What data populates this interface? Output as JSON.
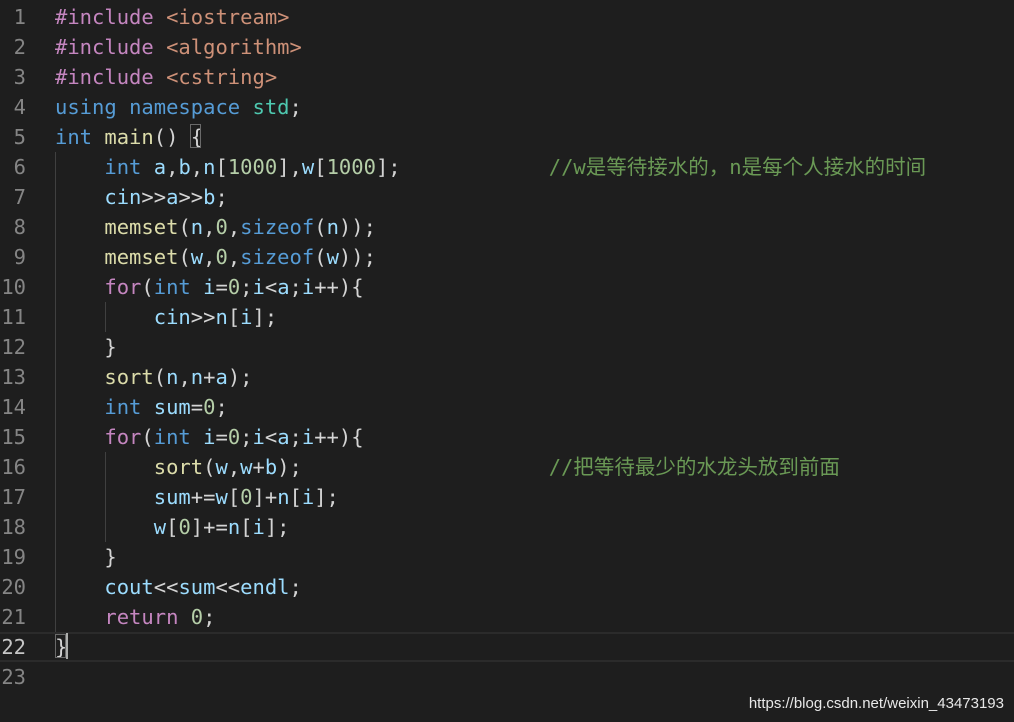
{
  "editor": {
    "lines": [
      [
        [
          "t-pre",
          "#include "
        ],
        [
          "t-str",
          "<iostream>"
        ]
      ],
      [
        [
          "t-pre",
          "#include "
        ],
        [
          "t-str",
          "<algorithm>"
        ]
      ],
      [
        [
          "t-pre",
          "#include "
        ],
        [
          "t-str",
          "<cstring>"
        ]
      ],
      [
        [
          "t-kw",
          "using "
        ],
        [
          "t-kw",
          "namespace "
        ],
        [
          "t-typ",
          "std"
        ],
        [
          "t-txt",
          ";"
        ]
      ],
      [
        [
          "t-kw",
          "int "
        ],
        [
          "t-fn",
          "main"
        ],
        [
          "t-txt",
          "() {"
        ]
      ],
      [
        [
          "t-txt",
          "    "
        ],
        [
          "t-kw",
          "int "
        ],
        [
          "t-var",
          "a"
        ],
        [
          "t-txt",
          ","
        ],
        [
          "t-var",
          "b"
        ],
        [
          "t-txt",
          ","
        ],
        [
          "t-var",
          "n"
        ],
        [
          "t-txt",
          "["
        ],
        [
          "t-num",
          "1000"
        ],
        [
          "t-txt",
          "],"
        ],
        [
          "t-var",
          "w"
        ],
        [
          "t-txt",
          "["
        ],
        [
          "t-num",
          "1000"
        ],
        [
          "t-txt",
          "];            "
        ],
        [
          "t-cmt",
          "//w是等待接水的，n是每个人接水的时间"
        ]
      ],
      [
        [
          "t-txt",
          "    "
        ],
        [
          "t-var",
          "cin"
        ],
        [
          "t-txt",
          ">>"
        ],
        [
          "t-var",
          "a"
        ],
        [
          "t-txt",
          ">>"
        ],
        [
          "t-var",
          "b"
        ],
        [
          "t-txt",
          ";"
        ]
      ],
      [
        [
          "t-txt",
          "    "
        ],
        [
          "t-fn",
          "memset"
        ],
        [
          "t-txt",
          "("
        ],
        [
          "t-var",
          "n"
        ],
        [
          "t-txt",
          ","
        ],
        [
          "t-num",
          "0"
        ],
        [
          "t-txt",
          ","
        ],
        [
          "t-kw",
          "sizeof"
        ],
        [
          "t-txt",
          "("
        ],
        [
          "t-var",
          "n"
        ],
        [
          "t-txt",
          "));"
        ]
      ],
      [
        [
          "t-txt",
          "    "
        ],
        [
          "t-fn",
          "memset"
        ],
        [
          "t-txt",
          "("
        ],
        [
          "t-var",
          "w"
        ],
        [
          "t-txt",
          ","
        ],
        [
          "t-num",
          "0"
        ],
        [
          "t-txt",
          ","
        ],
        [
          "t-kw",
          "sizeof"
        ],
        [
          "t-txt",
          "("
        ],
        [
          "t-var",
          "w"
        ],
        [
          "t-txt",
          "));"
        ]
      ],
      [
        [
          "t-txt",
          "    "
        ],
        [
          "t-ctl",
          "for"
        ],
        [
          "t-txt",
          "("
        ],
        [
          "t-kw",
          "int "
        ],
        [
          "t-var",
          "i"
        ],
        [
          "t-txt",
          "="
        ],
        [
          "t-num",
          "0"
        ],
        [
          "t-txt",
          ";"
        ],
        [
          "t-var",
          "i"
        ],
        [
          "t-txt",
          "<"
        ],
        [
          "t-var",
          "a"
        ],
        [
          "t-txt",
          ";"
        ],
        [
          "t-var",
          "i"
        ],
        [
          "t-txt",
          "++){"
        ]
      ],
      [
        [
          "t-txt",
          "        "
        ],
        [
          "t-var",
          "cin"
        ],
        [
          "t-txt",
          ">>"
        ],
        [
          "t-var",
          "n"
        ],
        [
          "t-txt",
          "["
        ],
        [
          "t-var",
          "i"
        ],
        [
          "t-txt",
          "];"
        ]
      ],
      [
        [
          "t-txt",
          "    }"
        ]
      ],
      [
        [
          "t-txt",
          "    "
        ],
        [
          "t-fn",
          "sort"
        ],
        [
          "t-txt",
          "("
        ],
        [
          "t-var",
          "n"
        ],
        [
          "t-txt",
          ","
        ],
        [
          "t-var",
          "n"
        ],
        [
          "t-txt",
          "+"
        ],
        [
          "t-var",
          "a"
        ],
        [
          "t-txt",
          ");"
        ]
      ],
      [
        [
          "t-txt",
          "    "
        ],
        [
          "t-kw",
          "int "
        ],
        [
          "t-var",
          "sum"
        ],
        [
          "t-txt",
          "="
        ],
        [
          "t-num",
          "0"
        ],
        [
          "t-txt",
          ";"
        ]
      ],
      [
        [
          "t-txt",
          "    "
        ],
        [
          "t-ctl",
          "for"
        ],
        [
          "t-txt",
          "("
        ],
        [
          "t-kw",
          "int "
        ],
        [
          "t-var",
          "i"
        ],
        [
          "t-txt",
          "="
        ],
        [
          "t-num",
          "0"
        ],
        [
          "t-txt",
          ";"
        ],
        [
          "t-var",
          "i"
        ],
        [
          "t-txt",
          "<"
        ],
        [
          "t-var",
          "a"
        ],
        [
          "t-txt",
          ";"
        ],
        [
          "t-var",
          "i"
        ],
        [
          "t-txt",
          "++){"
        ]
      ],
      [
        [
          "t-txt",
          "        "
        ],
        [
          "t-fn",
          "sort"
        ],
        [
          "t-txt",
          "("
        ],
        [
          "t-var",
          "w"
        ],
        [
          "t-txt",
          ","
        ],
        [
          "t-var",
          "w"
        ],
        [
          "t-txt",
          "+"
        ],
        [
          "t-var",
          "b"
        ],
        [
          "t-txt",
          ");                    "
        ],
        [
          "t-cmt",
          "//把等待最少的水龙头放到前面"
        ]
      ],
      [
        [
          "t-txt",
          "        "
        ],
        [
          "t-var",
          "sum"
        ],
        [
          "t-txt",
          "+="
        ],
        [
          "t-var",
          "w"
        ],
        [
          "t-txt",
          "["
        ],
        [
          "t-num",
          "0"
        ],
        [
          "t-txt",
          "]+"
        ],
        [
          "t-var",
          "n"
        ],
        [
          "t-txt",
          "["
        ],
        [
          "t-var",
          "i"
        ],
        [
          "t-txt",
          "];"
        ]
      ],
      [
        [
          "t-txt",
          "        "
        ],
        [
          "t-var",
          "w"
        ],
        [
          "t-txt",
          "["
        ],
        [
          "t-num",
          "0"
        ],
        [
          "t-txt",
          "]+="
        ],
        [
          "t-var",
          "n"
        ],
        [
          "t-txt",
          "["
        ],
        [
          "t-var",
          "i"
        ],
        [
          "t-txt",
          "];"
        ]
      ],
      [
        [
          "t-txt",
          "    }"
        ]
      ],
      [
        [
          "t-txt",
          "    "
        ],
        [
          "t-var",
          "cout"
        ],
        [
          "t-txt",
          "<<"
        ],
        [
          "t-var",
          "sum"
        ],
        [
          "t-txt",
          "<<"
        ],
        [
          "t-var",
          "endl"
        ],
        [
          "t-txt",
          ";"
        ]
      ],
      [
        [
          "t-txt",
          "    "
        ],
        [
          "t-ctl",
          "return "
        ],
        [
          "t-num",
          "0"
        ],
        [
          "t-txt",
          ";"
        ]
      ],
      [
        [
          "t-txt",
          "}"
        ]
      ],
      []
    ],
    "line_numbers": [
      "1",
      "2",
      "3",
      "4",
      "5",
      "6",
      "7",
      "8",
      "9",
      "10",
      "11",
      "12",
      "13",
      "14",
      "15",
      "16",
      "17",
      "18",
      "19",
      "20",
      "21",
      "22",
      "23"
    ],
    "current_line": 22
  },
  "watermark": "https://blog.csdn.net/weixin_43473193"
}
